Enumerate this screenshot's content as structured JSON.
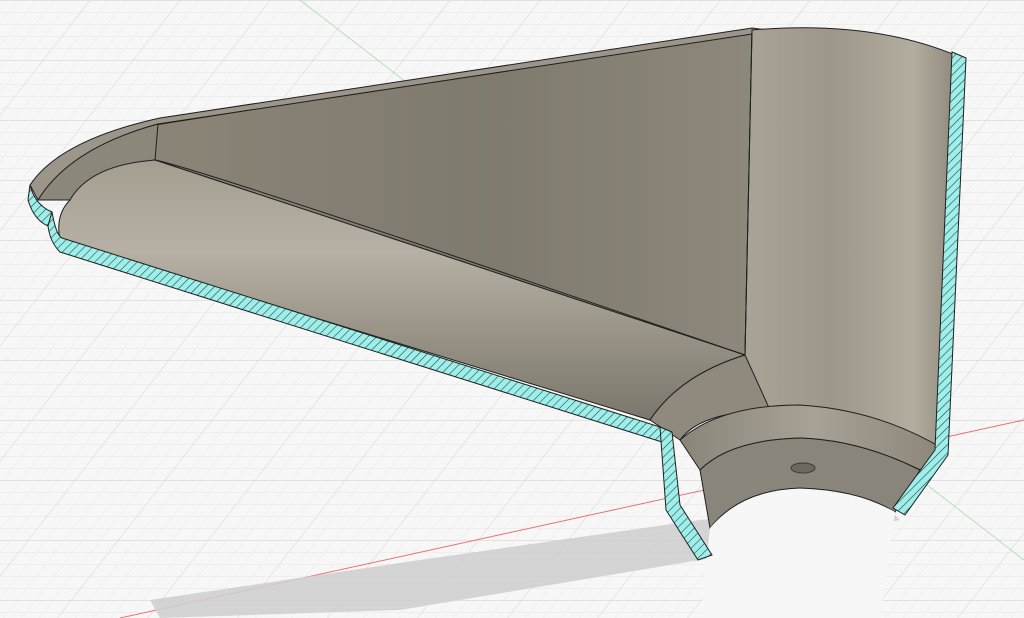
{
  "viewport": {
    "background_color": "#f7f7f7",
    "grid_minor_color": "#e6e6e6",
    "grid_major_color": "#d2d2d2",
    "axis_x_color": "#e57373",
    "axis_y_color": "#8fd18f"
  },
  "model": {
    "surface_color": "#8d8779",
    "surface_light_color": "#b2ad9f",
    "surface_dark_color": "#6f6a5f",
    "section_fill_color": "#9eefea",
    "section_hatch_color": "#2d4444",
    "edge_color": "#1f1f1f",
    "shadow_color": "#c9c9c9"
  }
}
